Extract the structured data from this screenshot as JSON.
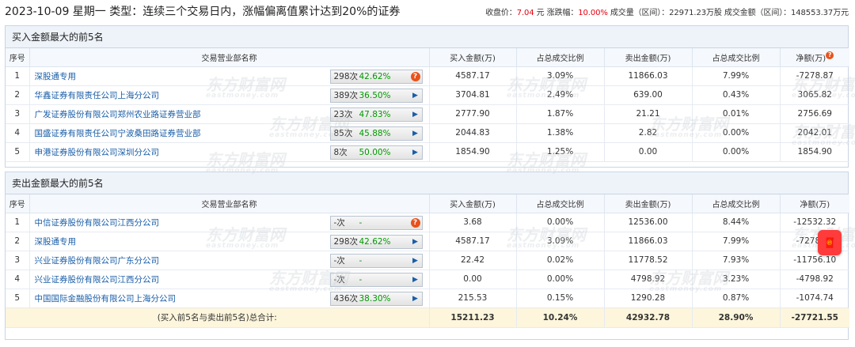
{
  "header": {
    "title": "2023-10-09 星期一 类型：连续三个交易日内，涨幅偏离值累计达到20%的证券",
    "close_label": "收盘价：",
    "close_value": "7.04",
    "close_unit": "元",
    "change_label": "涨跌幅：",
    "change_value": "10.00%",
    "volume_text": "成交量（区间）：22971.23万股",
    "amount_text": "成交金额（区间）：148553.37万元"
  },
  "columns": {
    "seq": "序号",
    "broker": "交易营业部名称",
    "buy": "买入金额(万)",
    "buy_ratio": "占总成交比例",
    "sell": "卖出金额(万)",
    "sell_ratio": "占总成交比例",
    "net": "净额(万)"
  },
  "watermark": {
    "main": "东方财富网",
    "sub": "eastmoney.com"
  },
  "buy_section": {
    "title": "买入金额最大的前5名",
    "rows": [
      {
        "seq": "1",
        "name": "深股通专用",
        "count": "298次",
        "pct": "42.62%",
        "buy": "4587.17",
        "buy_ratio": "3.09%",
        "sell": "11866.03",
        "sell_ratio": "7.99%",
        "net": "-7278.87",
        "net_color": "green",
        "icon": "question"
      },
      {
        "seq": "2",
        "name": "华鑫证券有限责任公司上海分公司",
        "count": "389次",
        "pct": "36.50%",
        "buy": "3704.81",
        "buy_ratio": "2.49%",
        "sell": "639.00",
        "sell_ratio": "0.43%",
        "net": "3065.82",
        "net_color": "red",
        "icon": "arrow"
      },
      {
        "seq": "3",
        "name": "广发证券股份有限公司郑州农业路证券营业部",
        "count": "23次",
        "pct": "47.83%",
        "buy": "2777.90",
        "buy_ratio": "1.87%",
        "sell": "21.21",
        "sell_ratio": "0.01%",
        "net": "2756.69",
        "net_color": "red",
        "icon": "arrow"
      },
      {
        "seq": "4",
        "name": "国盛证券有限责任公司宁波桑田路证券营业部",
        "count": "85次",
        "pct": "45.88%",
        "buy": "2044.83",
        "buy_ratio": "1.38%",
        "sell": "2.82",
        "sell_ratio": "0.00%",
        "net": "2042.01",
        "net_color": "red",
        "icon": "arrow"
      },
      {
        "seq": "5",
        "name": "申港证券股份有限公司深圳分公司",
        "count": "8次",
        "pct": "50.00%",
        "buy": "1854.90",
        "buy_ratio": "1.25%",
        "sell": "0.00",
        "sell_ratio": "0.00%",
        "net": "1854.90",
        "net_color": "red",
        "icon": "arrow"
      }
    ]
  },
  "sell_section": {
    "title": "卖出金额最大的前5名",
    "rows": [
      {
        "seq": "1",
        "name": "中信证券股份有限公司江西分公司",
        "count": "-次",
        "pct": "-",
        "buy": "3.68",
        "buy_ratio": "0.00%",
        "sell": "12536.00",
        "sell_ratio": "8.44%",
        "net": "-12532.32",
        "net_color": "green",
        "icon": "question"
      },
      {
        "seq": "2",
        "name": "深股通专用",
        "count": "298次",
        "pct": "42.62%",
        "buy": "4587.17",
        "buy_ratio": "3.09%",
        "sell": "11866.03",
        "sell_ratio": "7.99%",
        "net": "-7278.87",
        "net_color": "green",
        "icon": "arrow"
      },
      {
        "seq": "3",
        "name": "兴业证券股份有限公司广东分公司",
        "count": "-次",
        "pct": "-",
        "buy": "22.42",
        "buy_ratio": "0.02%",
        "sell": "11778.52",
        "sell_ratio": "7.93%",
        "net": "-11756.10",
        "net_color": "green",
        "icon": "arrow"
      },
      {
        "seq": "4",
        "name": "兴业证券股份有限公司江西分公司",
        "count": "-次",
        "pct": "-",
        "buy": "0.00",
        "buy_ratio": "0.00%",
        "sell": "4798.92",
        "sell_ratio": "3.23%",
        "net": "-4798.92",
        "net_color": "green",
        "icon": "arrow"
      },
      {
        "seq": "5",
        "name": "中国国际金融股份有限公司上海分公司",
        "count": "436次",
        "pct": "38.30%",
        "buy": "215.53",
        "buy_ratio": "0.15%",
        "sell": "1290.28",
        "sell_ratio": "0.87%",
        "net": "-1074.74",
        "net_color": "green",
        "icon": "arrow"
      }
    ],
    "total": {
      "label": "(买入前5名与卖出前5名)总合计:",
      "buy": "15211.23",
      "buy_ratio": "10.24%",
      "sell": "42932.78",
      "sell_ratio": "28.90%",
      "net": "-27721.55"
    }
  },
  "colors": {
    "red": "#e60012",
    "green": "#009900",
    "broker_link": "#1a5ea8",
    "header_bg": "#eef3fa",
    "total_bg": "#fdf6dc"
  }
}
